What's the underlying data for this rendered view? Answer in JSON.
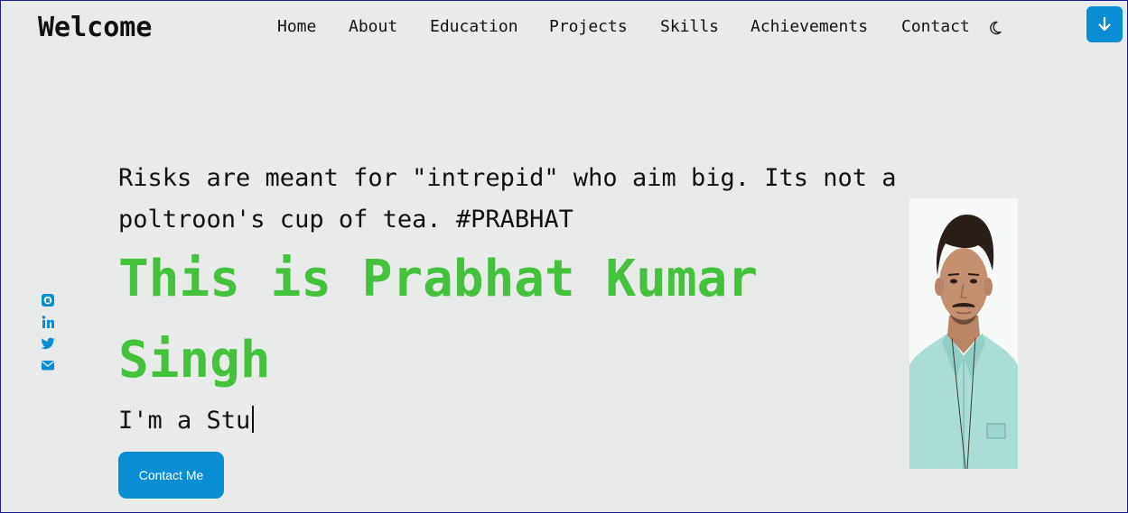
{
  "brand": "Welcome",
  "nav": {
    "items": [
      {
        "label": "Home"
      },
      {
        "label": "About"
      },
      {
        "label": "Education"
      },
      {
        "label": "Projects"
      },
      {
        "label": "Skills"
      },
      {
        "label": "Achievements"
      },
      {
        "label": "Contact"
      }
    ],
    "theme_toggle_icon": "moon-icon"
  },
  "scroll_button_icon": "arrow-down-icon",
  "socials": [
    {
      "icon": "github-icon"
    },
    {
      "icon": "linkedin-icon"
    },
    {
      "icon": "twitter-icon"
    },
    {
      "icon": "envelope-icon"
    }
  ],
  "hero": {
    "quote": "Risks are meant for \"intrepid\" who aim big. Its not a poltroon's cup of tea. #PRABHAT",
    "headline": "This is Prabhat Kumar Singh",
    "typed_text": "I'm a Stu",
    "contact_button": "Contact Me"
  },
  "colors": {
    "background": "#e9ebeb",
    "accent_blue": "#0a8ed3",
    "headline_green": "#44c23c"
  }
}
